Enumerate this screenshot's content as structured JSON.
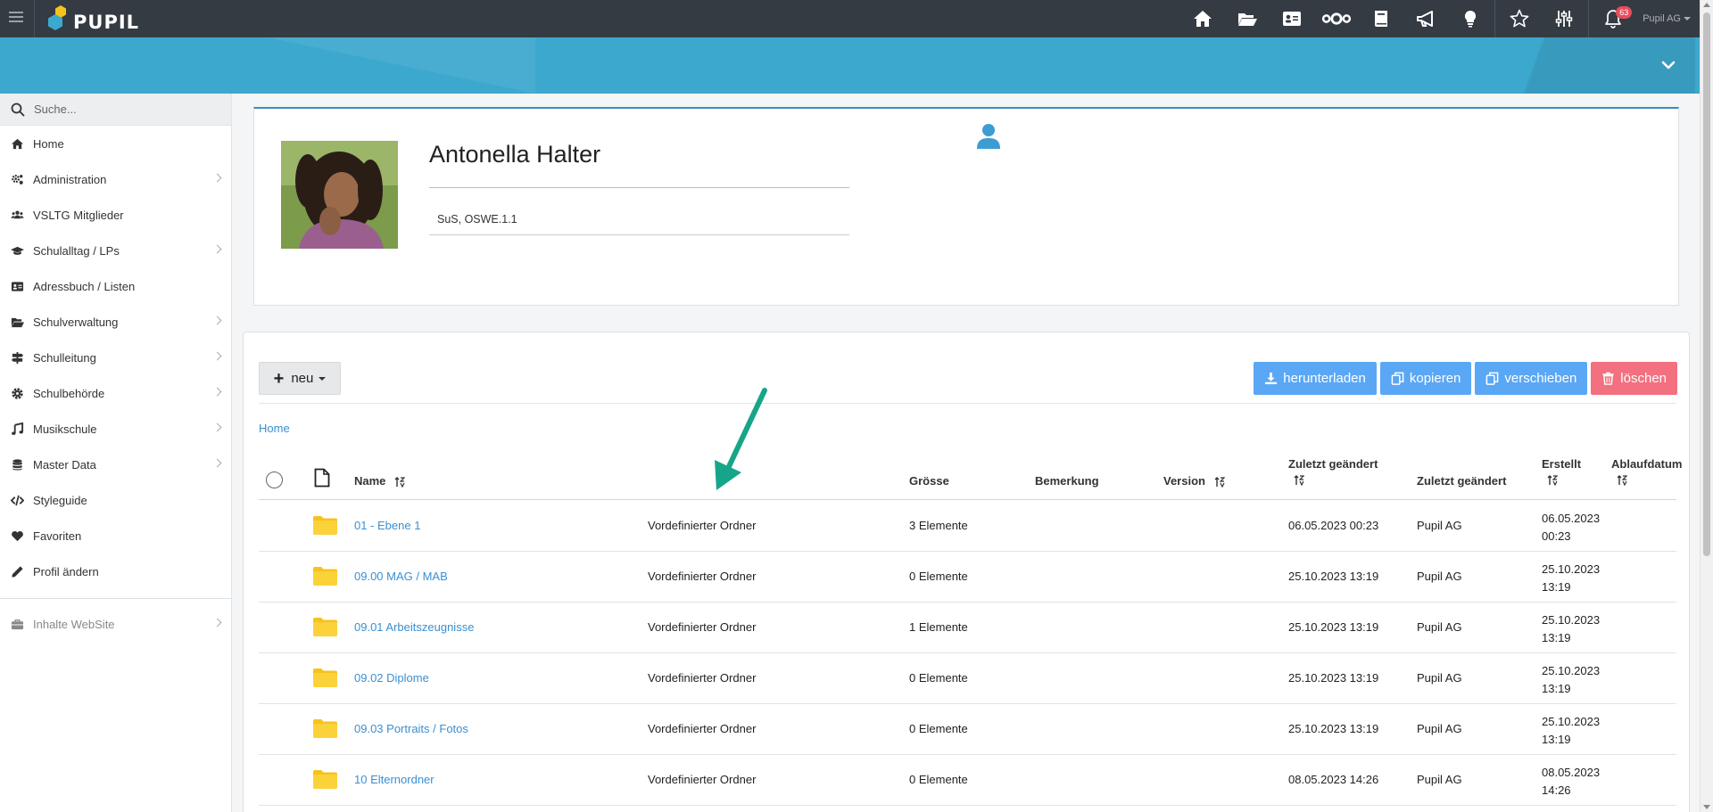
{
  "brand": {
    "name": "PUPIL"
  },
  "topbar": {
    "icons": [
      "home-icon",
      "folder-open-icon",
      "id-card-icon",
      "network-icon",
      "book-icon",
      "megaphone-icon",
      "lightbulb-icon",
      "star-icon",
      "sliders-icon",
      "bell-icon"
    ],
    "notification_count": "63",
    "user_label": "Pupil AG"
  },
  "sidebar": {
    "search_placeholder": "Suche...",
    "items": [
      {
        "label": "Home",
        "icon": "home-icon",
        "has_children": false
      },
      {
        "label": "Administration",
        "icon": "cogs-icon",
        "has_children": true
      },
      {
        "label": "VSLTG Mitglieder",
        "icon": "users-icon",
        "has_children": false
      },
      {
        "label": "Schulalltag / LPs",
        "icon": "graduation-cap-icon",
        "has_children": true
      },
      {
        "label": "Adressbuch / Listen",
        "icon": "address-card-icon",
        "has_children": false
      },
      {
        "label": "Schulverwaltung",
        "icon": "folder-open-icon",
        "has_children": true
      },
      {
        "label": "Schulleitung",
        "icon": "signpost-icon",
        "has_children": true
      },
      {
        "label": "Schulbehörde",
        "icon": "cog-icon",
        "has_children": true
      },
      {
        "label": "Musikschule",
        "icon": "music-icon",
        "has_children": true
      },
      {
        "label": "Master Data",
        "icon": "database-icon",
        "has_children": true
      },
      {
        "label": "Styleguide",
        "icon": "code-icon",
        "has_children": false
      },
      {
        "label": "Favoriten",
        "icon": "heart-icon",
        "has_children": false
      },
      {
        "label": "Profil ändern",
        "icon": "pencil-icon",
        "has_children": false
      }
    ],
    "footer_item": {
      "label": "Inhalte WebSite",
      "icon": "briefcase-icon",
      "has_children": true
    }
  },
  "profile": {
    "name": "Antonella Halter",
    "info": "SuS, OSWE.1.1"
  },
  "files": {
    "new_label": "neu",
    "actions": {
      "download": "herunterladen",
      "copy": "kopieren",
      "move": "verschieben",
      "delete": "löschen"
    },
    "breadcrumb": "Home",
    "columns": {
      "name": "Name",
      "size": "Grösse",
      "remark": "Bemerkung",
      "version": "Version",
      "modified_at": "Zuletzt geändert",
      "modified_by": "Zuletzt geändert",
      "created": "Erstellt",
      "expiry": "Ablaufdatum"
    },
    "rows": [
      {
        "name": "01 - Ebene 1",
        "type": "Vordefinierter Ordner",
        "size": "3 Elemente",
        "modified_at": "06.05.2023 00:23",
        "modified_by": "Pupil AG",
        "created_date": "06.05.2023",
        "created_time": "00:23"
      },
      {
        "name": "09.00 MAG / MAB",
        "type": "Vordefinierter Ordner",
        "size": "0 Elemente",
        "modified_at": "25.10.2023 13:19",
        "modified_by": "Pupil AG",
        "created_date": "25.10.2023",
        "created_time": "13:19"
      },
      {
        "name": "09.01 Arbeitszeugnisse",
        "type": "Vordefinierter Ordner",
        "size": "1 Elemente",
        "modified_at": "25.10.2023 13:19",
        "modified_by": "Pupil AG",
        "created_date": "25.10.2023",
        "created_time": "13:19"
      },
      {
        "name": "09.02 Diplome",
        "type": "Vordefinierter Ordner",
        "size": "0 Elemente",
        "modified_at": "25.10.2023 13:19",
        "modified_by": "Pupil AG",
        "created_date": "25.10.2023",
        "created_time": "13:19"
      },
      {
        "name": "09.03 Portraits / Fotos",
        "type": "Vordefinierter Ordner",
        "size": "0 Elemente",
        "modified_at": "25.10.2023 13:19",
        "modified_by": "Pupil AG",
        "created_date": "25.10.2023",
        "created_time": "13:19"
      },
      {
        "name": "10 Elternordner",
        "type": "Vordefinierter Ordner",
        "size": "0 Elemente",
        "modified_at": "08.05.2023 14:26",
        "modified_by": "Pupil AG",
        "created_date": "08.05.2023",
        "created_time": "14:26"
      }
    ]
  },
  "colors": {
    "topbar": "#353b43",
    "banner": "#3da8ce",
    "accent_blue": "#5aa7f5",
    "danger": "#f2707f",
    "link": "#3b8fd0",
    "folder": "#f7c21b",
    "annotation_arrow": "#17a589"
  }
}
